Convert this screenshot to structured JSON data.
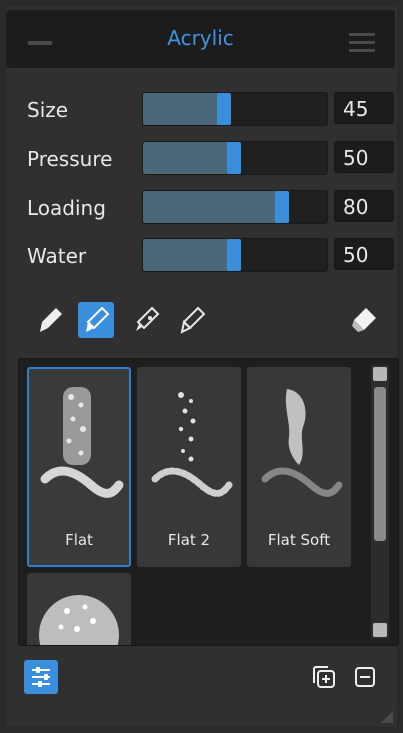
{
  "panel": {
    "title": "Acrylic"
  },
  "sliders": [
    {
      "label": "Size",
      "value": "45",
      "fraction": 0.45
    },
    {
      "label": "Pressure",
      "value": "50",
      "fraction": 0.5
    },
    {
      "label": "Loading",
      "value": "80",
      "fraction": 0.8
    },
    {
      "label": "Water",
      "value": "50",
      "fraction": 0.5
    }
  ],
  "tools": [
    {
      "name": "brush-paint-icon"
    },
    {
      "name": "brush-paint-active-icon"
    },
    {
      "name": "brush-smudge-icon"
    },
    {
      "name": "brush-outline-icon"
    },
    {
      "name": "eraser-icon"
    }
  ],
  "presets": [
    {
      "label": "Flat"
    },
    {
      "label": "Flat 2"
    },
    {
      "label": "Flat Soft"
    },
    {
      "label": ""
    }
  ],
  "colors": {
    "accent": "#3a8fdc",
    "panel": "#303030",
    "dark": "#1c1c1c"
  }
}
